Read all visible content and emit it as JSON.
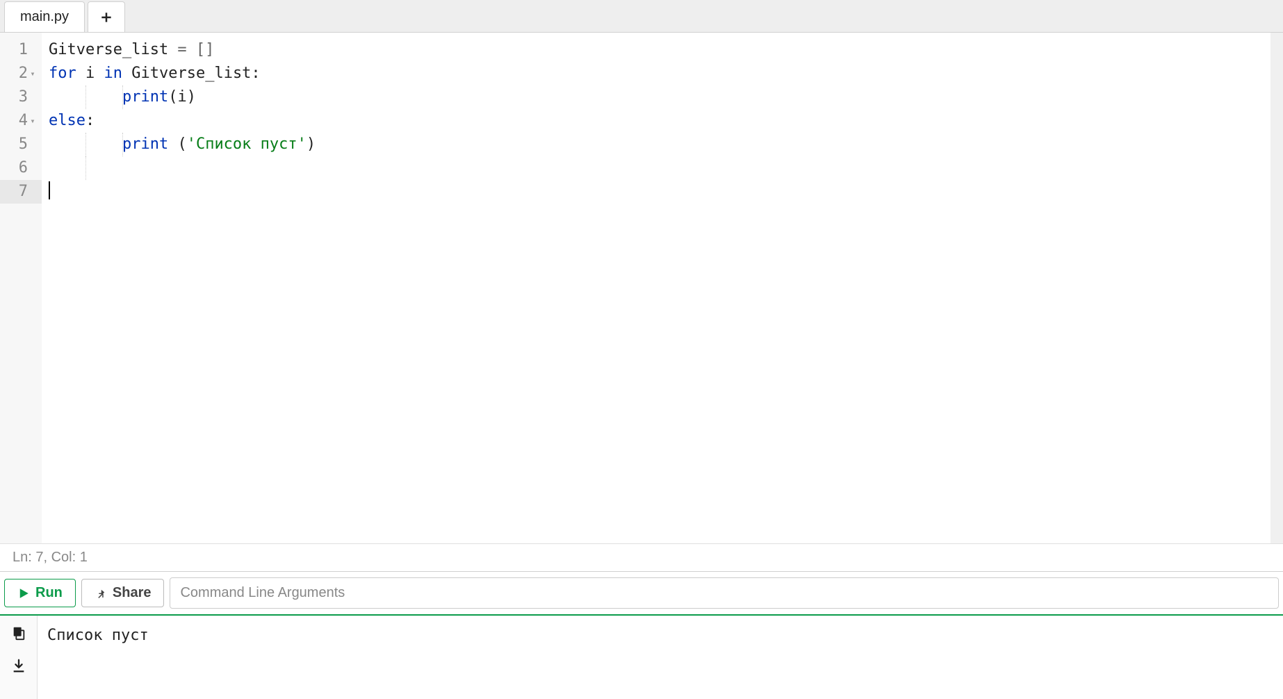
{
  "tabs": {
    "active": "main.py"
  },
  "code": {
    "lines": [
      {
        "num": "1",
        "fold": "",
        "tokens": [
          {
            "t": "ident",
            "v": "Gitverse_list"
          },
          {
            "t": "op",
            "v": " = []"
          }
        ]
      },
      {
        "num": "2",
        "fold": "▾",
        "tokens": [
          {
            "t": "kw",
            "v": "for"
          },
          {
            "t": "ident",
            "v": " i "
          },
          {
            "t": "kw",
            "v": "in"
          },
          {
            "t": "ident",
            "v": " Gitverse_list:"
          }
        ]
      },
      {
        "num": "3",
        "fold": "",
        "indent": 2,
        "tokens": [
          {
            "t": "kw",
            "v": "print"
          },
          {
            "t": "ident",
            "v": "(i)"
          }
        ]
      },
      {
        "num": "4",
        "fold": "▾",
        "tokens": [
          {
            "t": "kw",
            "v": "else"
          },
          {
            "t": "ident",
            "v": ":"
          }
        ]
      },
      {
        "num": "5",
        "fold": "",
        "indent": 2,
        "tokens": [
          {
            "t": "kw",
            "v": "print"
          },
          {
            "t": "ident",
            "v": " ("
          },
          {
            "t": "str",
            "v": "'Список пуст'"
          },
          {
            "t": "ident",
            "v": ")"
          }
        ]
      },
      {
        "num": "6",
        "fold": "",
        "indent": 1,
        "tokens": []
      },
      {
        "num": "7",
        "fold": "",
        "active": true,
        "cursor": true,
        "tokens": []
      }
    ]
  },
  "status": {
    "text": "Ln: 7,  Col: 1"
  },
  "toolbar": {
    "run_label": "Run",
    "share_label": "Share",
    "cli_placeholder": "Command Line Arguments"
  },
  "output": {
    "text": "Список пуст"
  }
}
